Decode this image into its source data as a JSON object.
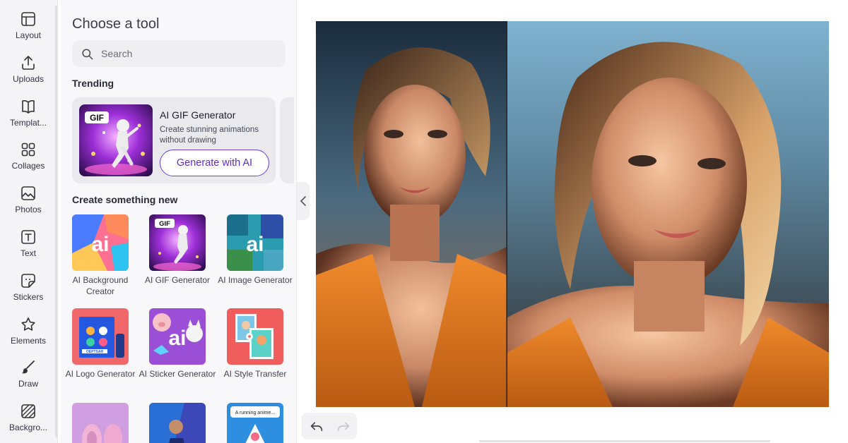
{
  "sidebar": {
    "items": [
      {
        "label": "Layout",
        "icon": "layout-icon"
      },
      {
        "label": "Uploads",
        "icon": "upload-icon"
      },
      {
        "label": "Templat...",
        "icon": "book-icon"
      },
      {
        "label": "Collages",
        "icon": "grid-icon"
      },
      {
        "label": "Photos",
        "icon": "photo-icon"
      },
      {
        "label": "Text",
        "icon": "text-icon"
      },
      {
        "label": "Stickers",
        "icon": "sticker-icon"
      },
      {
        "label": "Elements",
        "icon": "star-icon"
      },
      {
        "label": "Draw",
        "icon": "brush-icon"
      },
      {
        "label": "Backgro...",
        "icon": "background-icon"
      }
    ]
  },
  "panel": {
    "title": "Choose a tool",
    "search_placeholder": "Search",
    "trending_title": "Trending",
    "trending_card": {
      "thumb_badge": "GIF",
      "name": "AI GIF Generator",
      "description": "Create stunning animations without drawing",
      "button": "Generate with AI"
    },
    "create_title": "Create something new",
    "tiles": [
      {
        "label": "AI Background Creator",
        "art": "ai"
      },
      {
        "label": "AI GIF Generator",
        "art": "GIF"
      },
      {
        "label": "AI Image Generator",
        "art": "ai"
      },
      {
        "label": "AI Logo Generator",
        "art": "OEPTSAR"
      },
      {
        "label": "AI Sticker Generator",
        "art": "ai"
      },
      {
        "label": "AI Style Transfer",
        "art": ""
      },
      {
        "label": "",
        "art": ""
      },
      {
        "label": "",
        "art": ""
      },
      {
        "label": "",
        "art": "A running anime..."
      }
    ]
  },
  "colors": {
    "accent": "#6b3fd8",
    "panel_bg": "#f8f8fa",
    "rail_bg": "#f4f4f6"
  }
}
